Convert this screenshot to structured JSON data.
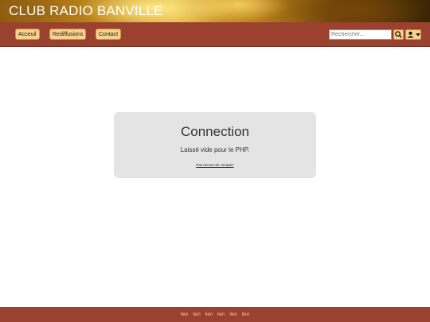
{
  "header": {
    "title": "CLUB RADIO BANVILLE"
  },
  "nav": {
    "items": [
      {
        "label": "Acceuil"
      },
      {
        "label": "Rediffusions"
      },
      {
        "label": "Contact"
      }
    ],
    "search": {
      "placeholder": "Rechercher...",
      "icon": "search-icon"
    },
    "user_menu": {
      "icon": "user-icon",
      "caret": "caret-down-icon"
    }
  },
  "login_card": {
    "title": "Connection",
    "text": "Laissé vide pour le PHP.",
    "signup_link": "Pas encore de compte?"
  },
  "footer": {
    "links": [
      "lien",
      "lien",
      "lien",
      "lien",
      "lien",
      "lien"
    ]
  },
  "colors": {
    "navbar": "#9b4130",
    "button": "#f7d28b",
    "card": "#e4e4e4"
  }
}
